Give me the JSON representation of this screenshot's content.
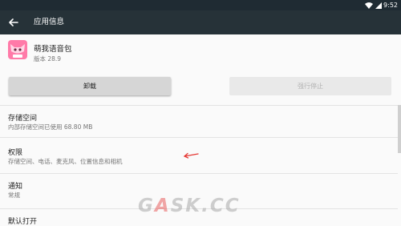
{
  "status_bar": {
    "time": "9:52",
    "icons": [
      "wifi-icon",
      "signal-icon",
      "battery-icon"
    ],
    "background": "#1f2b33"
  },
  "app_bar": {
    "title": "应用信息",
    "background": "#263238"
  },
  "app": {
    "name": "萌我语音包",
    "version": "版本 28.9",
    "icon_label": "萌我",
    "icon_color": "#ff7aa8"
  },
  "buttons": {
    "uninstall": "卸载",
    "force_stop": "强行停止"
  },
  "settings": [
    {
      "title": "存储空间",
      "summary": "内部存储空间已使用 68.80 MB"
    },
    {
      "title": "权限",
      "summary": "存储空间、电话、麦克风、位置信息和相机"
    },
    {
      "title": "通知",
      "summary": "常规"
    },
    {
      "title": "默认打开",
      "summary": ""
    }
  ],
  "annotation": {
    "arrow_color": "#e53935"
  },
  "watermark": {
    "prefix": "G",
    "mid": "A",
    "rest": "SK.CC"
  }
}
